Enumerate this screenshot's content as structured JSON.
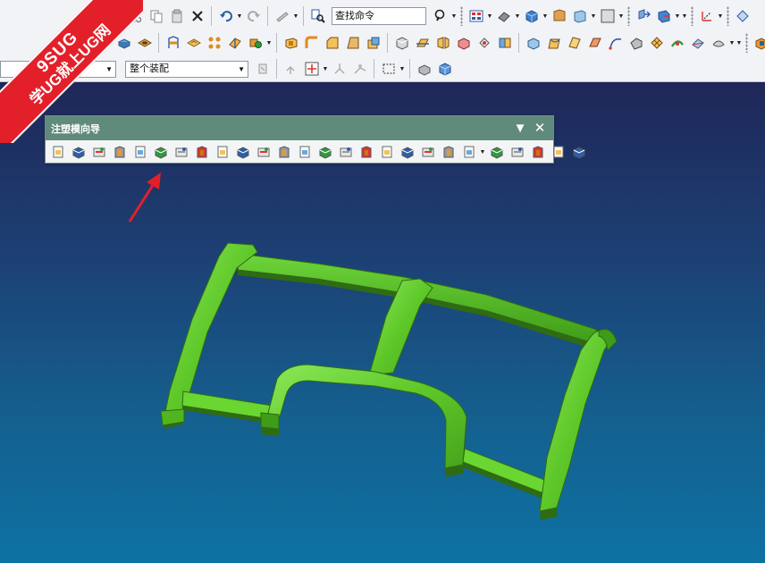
{
  "toolbar": {
    "search_placeholder": "查找命令",
    "assembly_filter": "整个装配",
    "left_combo": "",
    "row1_icons": [
      "cut-icon",
      "copy-icon",
      "paste-icon",
      "delete-icon",
      "undo-icon",
      "redo-icon",
      "repeat-command-icon",
      "find-command-icon",
      "magnify-icon",
      "view-layout-icon",
      "render-style-icon",
      "shaded-view-icon",
      "background-icon",
      "box-frame-icon",
      "snap-view-icon",
      "orient-view-icon",
      "wcs-icon",
      "more-icon"
    ],
    "row2_icons": [
      "extrude-icon",
      "revolve-icon",
      "hole-icon",
      "boss-icon",
      "pocket-icon",
      "pad-icon",
      "pattern-icon",
      "mirror-icon",
      "unite-icon",
      "subtract-icon",
      "intersect-icon",
      "shell-icon",
      "blend-icon",
      "chamfer-icon",
      "draft-icon",
      "offset-face-icon",
      "thicken-icon",
      "trim-body-icon",
      "split-body-icon",
      "sew-icon",
      "patch-icon",
      "extract-icon",
      "replace-face-icon",
      "move-face-icon",
      "delete-face-icon",
      "resize-icon",
      "curve-icon",
      "surface-icon",
      "mesh-icon",
      "swept-icon",
      "ruled-icon",
      "through-curves-icon",
      "section-icon"
    ],
    "row3_icons": [
      "selection-filter-icon",
      "select-icon",
      "snap-point-icon",
      "snap-line-icon",
      "rectangle-select-icon",
      "solid-shade-icon",
      "cube-view-icon"
    ]
  },
  "wizard": {
    "title": "注塑模向导",
    "icons": [
      "initialize-project-icon",
      "mold-csys-icon",
      "shrinkage-icon",
      "workpiece-icon",
      "cavity-layout-icon",
      "family-mold-icon",
      "mold-tools-icon",
      "parting-tools-icon",
      "mold-base-icon",
      "standard-part-icon",
      "ejector-pin-icon",
      "ejector-pin-postprocess-icon",
      "slider-lifter-icon",
      "sub-insert-icon",
      "gate-icon",
      "runner-icon",
      "cooling-icon",
      "electrode-icon",
      "trim-mold-components-icon",
      "pocket-icon",
      "bill-of-material-icon",
      "drawing-icon",
      "casting-process-icon",
      "view-manager-icon",
      "delete-files-icon",
      "mold-design-validation-icon"
    ]
  },
  "watermark": {
    "line1": "9SUG",
    "line2": "学UG就上UG网"
  },
  "colors": {
    "model_green": "#5fc829",
    "model_dark": "#2f6b13",
    "wizard_title_bg": "#5f8a7c",
    "ribbon_red": "#e3202a",
    "viewport_top": "#1f2758",
    "viewport_bottom": "#0d72a3"
  }
}
